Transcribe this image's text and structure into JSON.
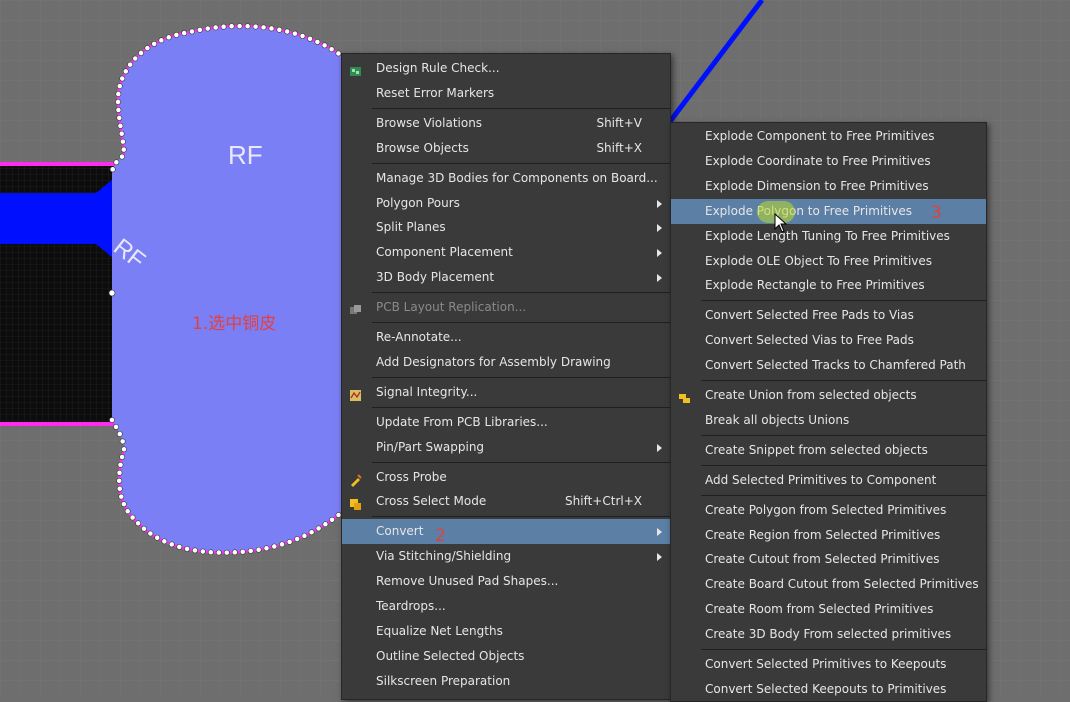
{
  "pcb": {
    "top_label": "RF",
    "side_label": "RF",
    "annotation_1": "1.选中铜皮"
  },
  "annotations": {
    "step2": "2",
    "step3": "3"
  },
  "context_menu": {
    "items": [
      {
        "label": "Design Rule Check...",
        "icon": "drc-icon"
      },
      {
        "label": "Reset Error Markers"
      },
      {
        "label": "Browse Violations",
        "shortcut": "Shift+V"
      },
      {
        "label": "Browse Objects",
        "shortcut": "Shift+X"
      },
      {
        "label": "Manage 3D Bodies for Components on Board..."
      },
      {
        "label": "Polygon Pours",
        "submenu": true
      },
      {
        "label": "Split Planes",
        "submenu": true
      },
      {
        "label": "Component Placement",
        "submenu": true
      },
      {
        "label": "3D Body Placement",
        "submenu": true
      },
      {
        "label": "PCB Layout Replication...",
        "disabled": true,
        "icon": "replication-icon"
      },
      {
        "label": "Re-Annotate..."
      },
      {
        "label": "Add Designators for Assembly Drawing"
      },
      {
        "label": "Signal Integrity...",
        "icon": "signal-integrity-icon"
      },
      {
        "label": "Update From PCB Libraries..."
      },
      {
        "label": "Pin/Part Swapping",
        "submenu": true
      },
      {
        "label": "Cross Probe",
        "icon": "cross-probe-icon"
      },
      {
        "label": "Cross Select Mode",
        "shortcut": "Shift+Ctrl+X",
        "icon": "cross-select-icon"
      },
      {
        "label": "Convert",
        "submenu": true,
        "highlighted": true
      },
      {
        "label": "Via Stitching/Shielding",
        "submenu": true
      },
      {
        "label": "Remove Unused Pad Shapes..."
      },
      {
        "label": "Teardrops..."
      },
      {
        "label": "Equalize Net Lengths"
      },
      {
        "label": "Outline Selected Objects"
      },
      {
        "label": "Silkscreen Preparation"
      }
    ]
  },
  "convert_submenu": {
    "items": [
      {
        "label": "Explode Component to Free Primitives"
      },
      {
        "label": "Explode Coordinate to Free Primitives"
      },
      {
        "label": "Explode Dimension to Free Primitives"
      },
      {
        "label": "Explode Polygon to Free Primitives",
        "highlighted": true
      },
      {
        "label": "Explode Length Tuning To Free Primitives"
      },
      {
        "label": "Explode OLE Object To Free Primitives"
      },
      {
        "label": "Explode Rectangle to Free Primitives"
      },
      {
        "label": "Convert Selected Free Pads to Vias"
      },
      {
        "label": "Convert Selected Vias to Free Pads"
      },
      {
        "label": "Convert Selected Tracks to Chamfered Path"
      },
      {
        "label": "Create Union from selected objects",
        "icon": "union-icon"
      },
      {
        "label": "Break all objects Unions"
      },
      {
        "label": "Create Snippet from selected objects"
      },
      {
        "label": "Add Selected Primitives to Component"
      },
      {
        "label": "Create Polygon from Selected Primitives"
      },
      {
        "label": "Create Region from Selected Primitives"
      },
      {
        "label": "Create Cutout from Selected Primitives"
      },
      {
        "label": "Create Board Cutout from Selected Primitives"
      },
      {
        "label": "Create Room from Selected Primitives"
      },
      {
        "label": "Create 3D Body From selected primitives"
      },
      {
        "label": "Convert Selected Primitives to Keepouts"
      },
      {
        "label": "Convert Selected Keepouts to Primitives"
      }
    ]
  },
  "colors": {
    "canvas": "#6e6e6e",
    "polygon_fill": "#7b7ff5",
    "board_outline": "#ff2cf0",
    "track": "#0010ff",
    "menu_bg": "#3a3a3a",
    "menu_highlight": "#5c7fa6"
  }
}
